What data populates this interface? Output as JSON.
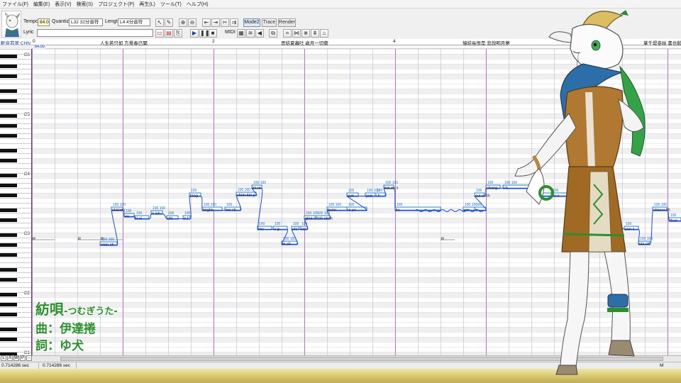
{
  "menu": [
    "ファイル(F)",
    "編集(E)",
    "表示(V)",
    "検索(S)",
    "プロジェクト(P)",
    "再生(L)",
    "ツール(T)",
    "ヘルプ(H)"
  ],
  "toolbar": {
    "tempo_label": "Tempo",
    "tempo_value": "84.00",
    "quantize_label": "Quantize",
    "quantize_value": "L32 32分音符",
    "length_label": "Length",
    "length_value": "L4 4分音符",
    "lyric_label": "Lyric",
    "lyric_value": "",
    "midi_label": "MIDI",
    "mode_label": "Mode2",
    "trace_label": "Trace",
    "render_label": "Render"
  },
  "track": {
    "name": "軒音翡翠 CHN"
  },
  "ruler": {
    "bars": [
      "0",
      "2",
      "4"
    ],
    "phrases": [
      "人生若只如 方覺春已闌",
      "思結夏蟲吐 歲月一切衝",
      "憶結長恨是 悲說明月夢",
      "掌千堤巻絲 書也鬆"
    ],
    "tempo_marker": "84.00"
  },
  "keyboard": {
    "labels": [
      "C6",
      "C5",
      "C4",
      "C3",
      "C2",
      "C1"
    ]
  },
  "notes": [
    {
      "lyric": "R"
    },
    {
      "lyric": "R"
    },
    {
      "lyric": "R"
    },
    {
      "lyric": "reen sh",
      "vel": "100 100"
    },
    {
      "lyric": "shimen",
      "vel": "100 100"
    },
    {
      "lyric": "vu",
      "vel": "100"
    },
    {
      "lyric": "ri vi",
      "vel": "100"
    },
    {
      "lyric": "ri ish",
      "vel": "100 100"
    },
    {
      "lyric": "shi",
      "vel": "100"
    },
    {
      "lyric": "n f",
      "vel": "100"
    },
    {
      "lyric": "fang",
      "vel": "100"
    },
    {
      "lyric": "tingtie",
      "vel": "100 100"
    },
    {
      "lyric": "ine ch",
      "vel": "100"
    },
    {
      "lyric": "chün lün y",
      "vel": "100 100"
    },
    {
      "lyric": "jin m",
      "vel": "100 100"
    },
    {
      "lyric": "mu",
      "vel": "100"
    },
    {
      "lyric": "u g",
      "vel": "100"
    },
    {
      "lyric": "ai sh",
      "vel": "100 100"
    },
    {
      "lyric": "shi",
      "vel": "100"
    },
    {
      "lyric": "ine",
      "vel": "100"
    },
    {
      "lyric": "gine dou",
      "vel": "100 100"
    },
    {
      "lyric": "tiah oin h",
      "vel": "100 100"
    },
    {
      "lyric": "bulai",
      "vel": "100 100"
    },
    {
      "lyric": "ui yu",
      "vel": "100"
    },
    {
      "lyric": "yue",
      "vel": "100"
    },
    {
      "lyric": "yue",
      "vel": "100 100"
    },
    {
      "lyric": "i h",
      "vel": "100"
    },
    {
      "lyric": "bai eu s",
      "vel": "100 100"
    },
    {
      "lyric": "liu",
      "vel": "100"
    },
    {
      "lyric": "R"
    },
    {
      "lyric": "yu",
      "vel": "100 100"
    },
    {
      "lyric": "ir",
      "vel": "100"
    },
    {
      "lyric": "sui ui ch",
      "vel": "100"
    },
    {
      "lyric": "chang",
      "vel": "100"
    },
    {
      "lyric": "i h",
      "vel": "100 100"
    },
    {
      "lyric": "u",
      "vel": "100"
    },
    {
      "lyric": "en s",
      "vel": "100"
    },
    {
      "lyric": "yan s",
      "vel": "100"
    },
    {
      "lyric": "shi ch",
      "vel": "100 100"
    },
    {
      "lyric": "shiouv sh",
      "vel": "100 100"
    },
    {
      "lyric": "thuo",
      "vel": "100"
    }
  ],
  "overlay": {
    "title": "紡唄",
    "subtitle": "-つむぎうた-",
    "composer": "曲：伊達捲",
    "lyricist": "詞：ゆ犬"
  },
  "status": {
    "time_left": "0.714286 sec",
    "time_right": "0.714286 sec",
    "mode_char": "M"
  },
  "zoom_buttons": [
    "L",
    "A",
    "W",
    "P",
    "-"
  ],
  "colors": {
    "note_line": "#2a7fd4",
    "pitch_line": "#1a4ad8",
    "accent": "#2b8f2e",
    "grid_bar": "#c070c8"
  }
}
